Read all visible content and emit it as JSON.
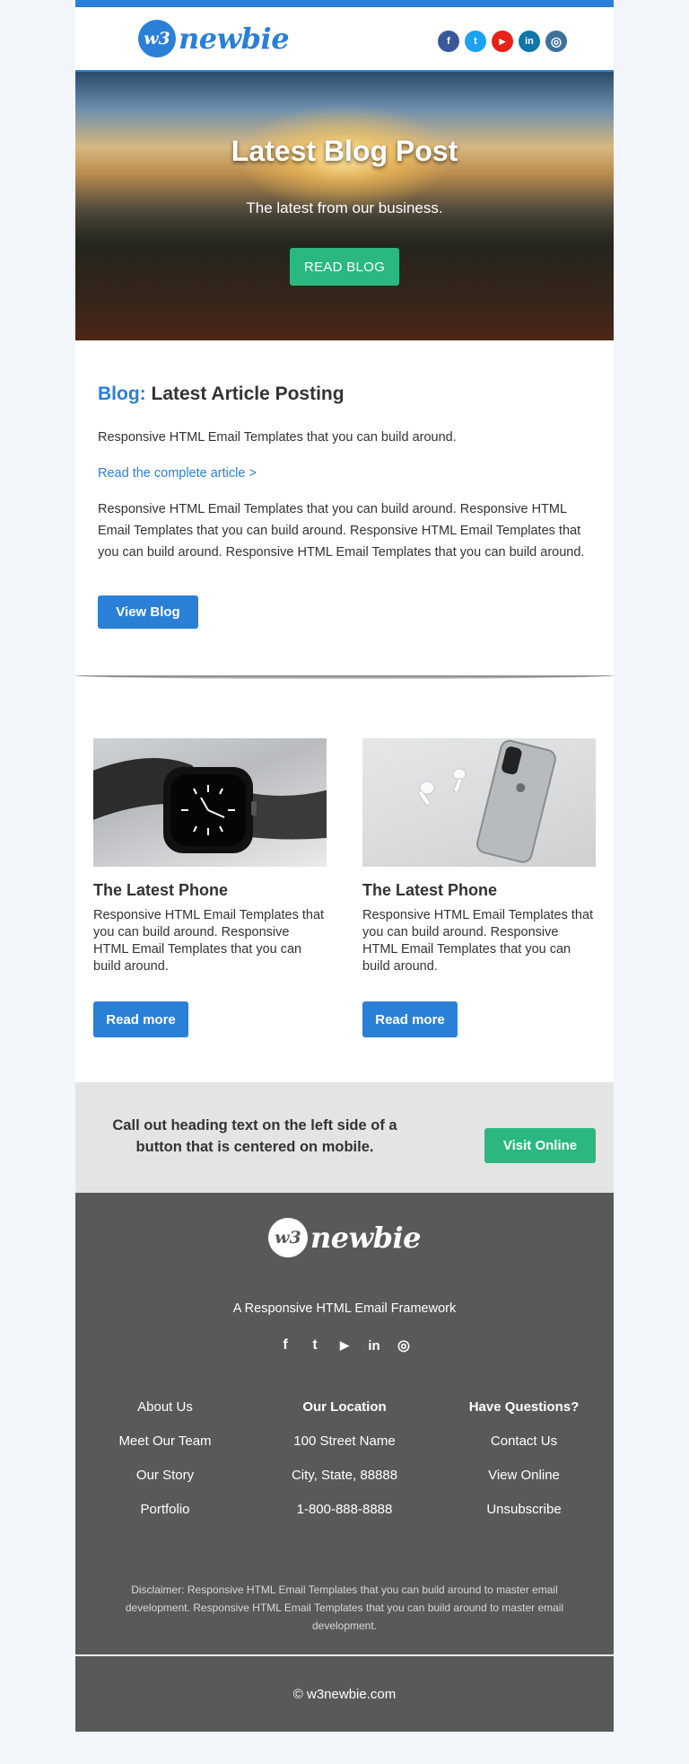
{
  "header": {
    "logo_badge": "w3",
    "logo_text": "newbie",
    "social_icons": [
      {
        "name": "facebook-icon",
        "glyph": "f",
        "color": "#3b5998"
      },
      {
        "name": "twitter-icon",
        "glyph": "t",
        "color": "#1da1f2"
      },
      {
        "name": "youtube-icon",
        "glyph": "▶",
        "color": "#e62117"
      },
      {
        "name": "linkedin-icon",
        "glyph": "in",
        "color": "#0e76a8"
      },
      {
        "name": "instagram-icon",
        "glyph": "◎",
        "color": "#3f729b"
      }
    ]
  },
  "hero": {
    "title": "Latest Blog Post",
    "subtitle": "The latest from our business.",
    "button": "READ BLOG"
  },
  "article": {
    "heading_prefix": "Blog:",
    "heading": " Latest Article Posting",
    "intro": "Responsive HTML Email Templates that you can build around.",
    "link": "Read the complete article >",
    "body": "Responsive HTML Email Templates that you can build around. Responsive HTML Email Templates that you can build around. Responsive HTML Email Templates that you can build around. Responsive HTML Email Templates that you can build around.",
    "button": "View Blog"
  },
  "cards": [
    {
      "title": "The Latest Phone",
      "text": "Responsive HTML Email Templates that you can build around. Responsive HTML Email Templates that you can build around.",
      "button": "Read more"
    },
    {
      "title": "The Latest Phone",
      "text": "Responsive HTML Email Templates that you can build around. Responsive HTML Email Templates that you can build around.",
      "button": "Read more"
    }
  ],
  "callout": {
    "text": "Call out heading text on the left side of a button that is centered on mobile.",
    "button": "Visit Online"
  },
  "footer": {
    "logo_badge": "w3",
    "logo_text": "newbie",
    "tagline": "A Responsive HTML Email Framework",
    "col1": [
      "About Us",
      "Meet Our Team",
      "Our Story",
      "Portfolio"
    ],
    "col2_head": "Our Location",
    "col2": [
      "100 Street Name",
      "City, State, 88888",
      "1-800-888-8888"
    ],
    "col3_head": "Have Questions?",
    "col3": [
      "Contact Us",
      "View Online",
      "Unsubscribe"
    ],
    "disclaimer": "Disclaimer: Responsive HTML Email Templates that you can build around to master email development. Responsive HTML Email Templates that you can build around to master email development.",
    "copyright": "© w3newbie.com"
  },
  "colors": {
    "primary": "#2a7fd6",
    "accent": "#2bb880",
    "footer": "#595959"
  }
}
